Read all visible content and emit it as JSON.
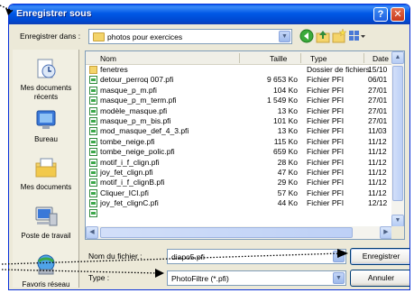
{
  "window": {
    "title": "Enregistrer sous"
  },
  "top": {
    "label": "Enregistrer dans :",
    "folder": "photos pour exercices"
  },
  "places": [
    {
      "label": "Mes documents récents"
    },
    {
      "label": "Bureau"
    },
    {
      "label": "Mes documents"
    },
    {
      "label": "Poste de travail"
    },
    {
      "label": "Favoris réseau"
    }
  ],
  "columns": {
    "name": "Nom",
    "size": "Taille",
    "type": "Type",
    "date": "Date"
  },
  "files": [
    {
      "name": "fenetres",
      "size": "",
      "type": "Dossier de fichiers",
      "date": "15/10",
      "kind": "folder"
    },
    {
      "name": "detour_perroq 007.pfi",
      "size": "9 653 Ko",
      "type": "Fichier PFI",
      "date": "06/01",
      "kind": "file"
    },
    {
      "name": "masque_p_m.pfi",
      "size": "104 Ko",
      "type": "Fichier PFI",
      "date": "27/01",
      "kind": "file"
    },
    {
      "name": "masque_p_m_term.pfi",
      "size": "1 549 Ko",
      "type": "Fichier PFI",
      "date": "27/01",
      "kind": "file"
    },
    {
      "name": "modèle_masque.pfi",
      "size": "13 Ko",
      "type": "Fichier PFI",
      "date": "27/01",
      "kind": "file"
    },
    {
      "name": "masque_p_m_bis.pfi",
      "size": "101 Ko",
      "type": "Fichier PFI",
      "date": "27/01",
      "kind": "file"
    },
    {
      "name": "mod_masque_def_4_3.pfi",
      "size": "13 Ko",
      "type": "Fichier PFI",
      "date": "11/03",
      "kind": "file"
    },
    {
      "name": "tombe_neige.pfi",
      "size": "115 Ko",
      "type": "Fichier PFI",
      "date": "11/12",
      "kind": "file"
    },
    {
      "name": "tombe_neige_polic.pfi",
      "size": "659 Ko",
      "type": "Fichier PFI",
      "date": "11/12",
      "kind": "file"
    },
    {
      "name": "motif_i_f_clign.pfi",
      "size": "28 Ko",
      "type": "Fichier PFI",
      "date": "11/12",
      "kind": "file"
    },
    {
      "name": "joy_fet_clign.pfi",
      "size": "47 Ko",
      "type": "Fichier PFI",
      "date": "11/12",
      "kind": "file"
    },
    {
      "name": "motif_i_f_clignB.pfi",
      "size": "29 Ko",
      "type": "Fichier PFI",
      "date": "11/12",
      "kind": "file"
    },
    {
      "name": "Cliquer_ICI.pfi",
      "size": "57 Ko",
      "type": "Fichier PFI",
      "date": "11/12",
      "kind": "file"
    },
    {
      "name": "joy_fet_clignC.pfi",
      "size": "44 Ko",
      "type": "Fichier PFI",
      "date": "12/12",
      "kind": "file"
    },
    {
      "name": "",
      "size": "",
      "type": "",
      "date": "",
      "kind": "file"
    }
  ],
  "filename": {
    "label": "Nom du fichier :",
    "value": "diapo5.pfi"
  },
  "filetype": {
    "label": "Type :",
    "value": "PhotoFiltre (*.pfi)"
  },
  "buttons": {
    "save": "Enregistrer",
    "cancel": "Annuler"
  },
  "colors": {
    "title_bar": "#0058E6",
    "dialog_bg": "#ECE9D8",
    "annotation_dots": "#000000"
  }
}
